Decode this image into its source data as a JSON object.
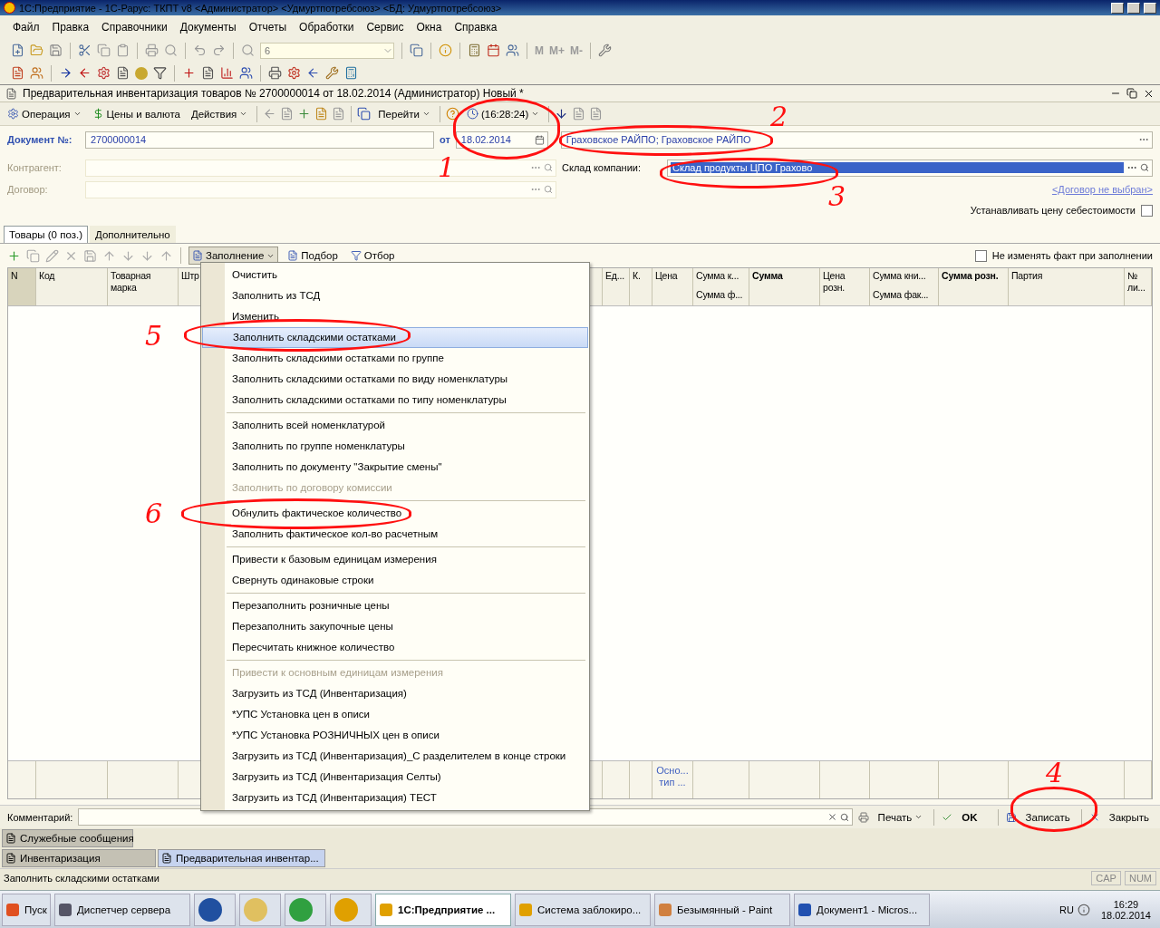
{
  "window": {
    "title": "1С:Предприятие - 1С-Рарус: ТКПТ v8 <Администратор> <Удмуртпотребсоюз> <БД: Удмуртпотребсоюз>"
  },
  "menu": [
    "Файл",
    "Правка",
    "Справочники",
    "Документы",
    "Отчеты",
    "Обработки",
    "Сервис",
    "Окна",
    "Справка"
  ],
  "toolbar": {
    "combo_value": "6",
    "memory_buttons": [
      "M",
      "M+",
      "M-"
    ]
  },
  "document": {
    "title": "Предварительная инвентаризация товаров № 2700000014 от 18.02.2014 (Администратор) Новый *",
    "actions": [
      {
        "label": "Операция",
        "dropdown": true
      },
      {
        "label": "Цены и валюта",
        "dropdown": false
      },
      {
        "label": "Действия",
        "dropdown": true
      },
      {
        "label": "Перейти",
        "dropdown": true
      },
      {
        "label": "(16:28:24)",
        "dropdown": true
      }
    ],
    "number_label": "Документ №:",
    "number": "2700000014",
    "date_label": "от",
    "date": "18.02.2014",
    "organization": "Граховское РАЙПО; Граховское РАЙПО",
    "counterparty_label": "Контрагент:",
    "contract_label": "Договор:",
    "warehouse_label": "Склад компании:",
    "warehouse": "Склад продукты ЦПО Грахово",
    "contract_link": "<Договор не выбран>",
    "cost_price": {
      "label": "Устанавливать цену себестоимости",
      "checked": false
    }
  },
  "tabs": [
    {
      "label": "Товары (0 поз.)",
      "selected": true
    },
    {
      "label": "Дополнительно",
      "selected": false
    }
  ],
  "table_toolbar": {
    "buttons": [
      {
        "label": "Заполнение",
        "pressed": true
      },
      {
        "label": "Подбор",
        "pressed": false
      },
      {
        "label": "Отбор",
        "pressed": false
      }
    ],
    "keep_fact": {
      "label": "Не изменять факт при заполнении",
      "checked": false
    }
  },
  "table": {
    "columns": [
      {
        "top": "N",
        "bold": false
      },
      {
        "top": "Код",
        "bold": false
      },
      {
        "top": "Товарная марка",
        "bold": false
      },
      {
        "top": "Штр",
        "bold": false
      },
      {
        "top": "Ед...",
        "bold": false
      },
      {
        "top": "К.",
        "bold": false
      },
      {
        "top": "Цена",
        "bold": false
      },
      {
        "top": "Сумма к...",
        "bottom": "Сумма ф...",
        "bold": false
      },
      {
        "top": "Сумма",
        "bold": true
      },
      {
        "top": "Цена розн.",
        "bold": false
      },
      {
        "top": "Сумма кни...",
        "bottom": "Сумма фак...",
        "bold": false
      },
      {
        "top": "Сумма розн.",
        "bold": true
      },
      {
        "top": "Партия",
        "bold": false
      },
      {
        "top": "№ ли...",
        "bold": false
      }
    ],
    "footer_cell": "Осно... тип ..."
  },
  "fill_menu": {
    "groups": [
      [
        {
          "label": "Очистить",
          "selected": false,
          "disabled": false
        },
        {
          "label": "Заполнить из ТСД",
          "selected": false,
          "disabled": false
        },
        {
          "label": "Изменить",
          "selected": false,
          "disabled": false
        },
        {
          "label": "Заполнить складскими остатками",
          "selected": true,
          "disabled": false
        },
        {
          "label": "Заполнить складскими остатками по группе",
          "selected": false,
          "disabled": false
        },
        {
          "label": "Заполнить складскими остатками по виду номенклатуры",
          "selected": false,
          "disabled": false
        },
        {
          "label": "Заполнить складскими остатками по типу номенклатуры",
          "selected": false,
          "disabled": false
        }
      ],
      [
        {
          "label": "Заполнить всей номенклатурой",
          "selected": false,
          "disabled": false
        },
        {
          "label": "Заполнить по группе номенклатуры",
          "selected": false,
          "disabled": false
        },
        {
          "label": "Заполнить по документу \"Закрытие смены\"",
          "selected": false,
          "disabled": false
        },
        {
          "label": "Заполнить по договору комиссии",
          "selected": false,
          "disabled": true
        }
      ],
      [
        {
          "label": "Обнулить фактическое количество",
          "selected": false,
          "disabled": false
        },
        {
          "label": "Заполнить фактическое кол-во расчетным",
          "selected": false,
          "disabled": false
        }
      ],
      [
        {
          "label": "Привести к базовым единицам измерения",
          "selected": false,
          "disabled": false
        },
        {
          "label": "Свернуть одинаковые строки",
          "selected": false,
          "disabled": false
        }
      ],
      [
        {
          "label": "Перезаполнить розничные цены",
          "selected": false,
          "disabled": false
        },
        {
          "label": "Перезаполнить закупочные цены",
          "selected": false,
          "disabled": false
        },
        {
          "label": "Пересчитать книжное количество",
          "selected": false,
          "disabled": false
        }
      ],
      [
        {
          "label": "Привести к основным единицам измерения",
          "selected": false,
          "disabled": true
        },
        {
          "label": "Загрузить из ТСД (Инвентаризация)",
          "selected": false,
          "disabled": false
        },
        {
          "label": "*УПС Установка цен в описи",
          "selected": false,
          "disabled": false
        },
        {
          "label": "*УПС Установка РОЗНИЧНЫХ цен в описи",
          "selected": false,
          "disabled": false
        },
        {
          "label": "Загрузить из ТСД (Инвентаризация)_С разделителем в конце строки",
          "selected": false,
          "disabled": false
        },
        {
          "label": "Загрузить из ТСД (Инвентаризация Селты)",
          "selected": false,
          "disabled": false
        },
        {
          "label": "Загрузить из ТСД (Инвентаризация) ТЕСТ",
          "selected": false,
          "disabled": false
        }
      ]
    ]
  },
  "bottom_bar": {
    "comment_label": "Комментарий:",
    "buttons": [
      {
        "label": "Печать",
        "kind": "print"
      },
      {
        "label": "OK",
        "kind": "ok"
      },
      {
        "label": "Записать",
        "kind": "save"
      },
      {
        "label": "Закрыть",
        "kind": "close"
      }
    ]
  },
  "service_messages": "Служебные сообщения",
  "open_windows": [
    {
      "label": "Инвентаризация",
      "selected": false
    },
    {
      "label": "Предварительная инвентар...",
      "selected": true
    }
  ],
  "status_bar": {
    "text": "Заполнить складскими остатками",
    "indicators": [
      "CAP",
      "NUM"
    ]
  },
  "taskbar": {
    "start": "Пуск",
    "items": [
      {
        "label": "Диспетчер сервера",
        "kind": "app",
        "selected": false
      },
      {
        "kind": "icon",
        "selected": false
      },
      {
        "kind": "icon",
        "selected": false
      },
      {
        "kind": "icon",
        "selected": false
      },
      {
        "kind": "icon",
        "selected": false
      },
      {
        "label": "1С:Предприятие ...",
        "kind": "app",
        "selected": true
      },
      {
        "label": "Система заблокиро...",
        "kind": "app",
        "selected": false
      },
      {
        "label": "Безымянный - Paint",
        "kind": "app",
        "selected": false
      },
      {
        "label": "Документ1 - Micros...",
        "kind": "app",
        "selected": false
      }
    ],
    "language": "RU",
    "time": "16:29",
    "date": "18.02.2014"
  },
  "annotations": [
    {
      "label": "1"
    },
    {
      "label": "2"
    },
    {
      "label": "3"
    },
    {
      "label": "4"
    },
    {
      "label": "5"
    },
    {
      "label": "6"
    }
  ]
}
